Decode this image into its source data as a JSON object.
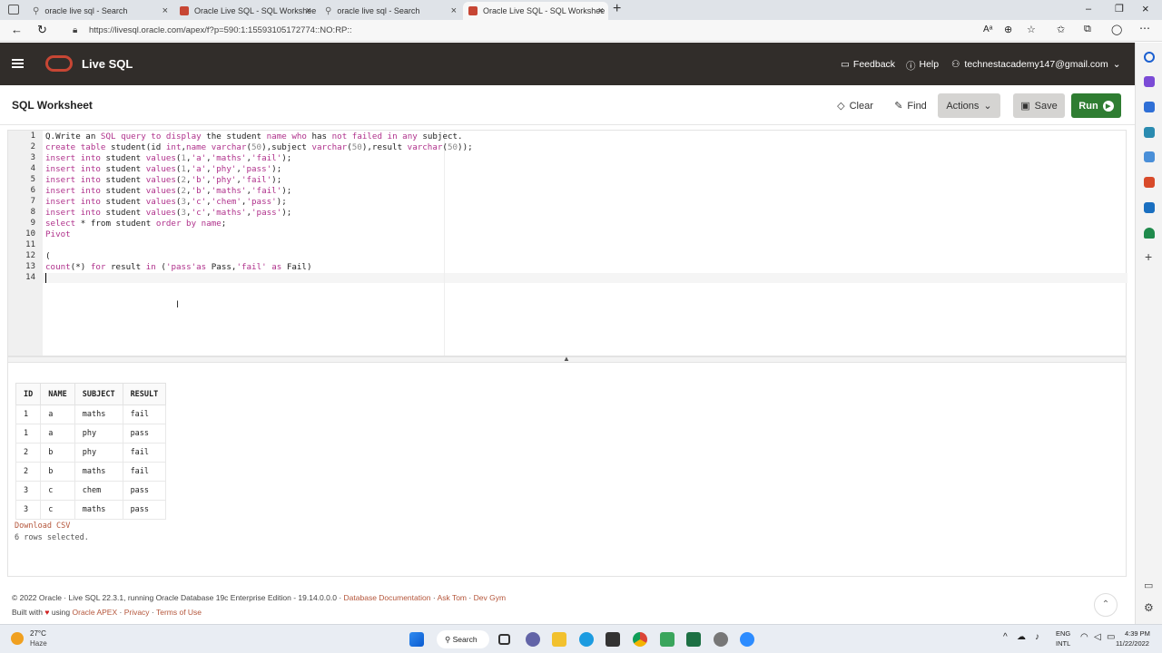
{
  "browser": {
    "tabs": [
      {
        "title": "oracle live sql - Search",
        "active": false
      },
      {
        "title": "Oracle Live SQL - SQL Workshee",
        "active": true
      },
      {
        "title": "oracle live sql - Search",
        "active": false
      },
      {
        "title": "Oracle Live SQL - SQL Workshee",
        "active": true
      }
    ],
    "new_tab": "+",
    "url": "https://livesql.oracle.com/apex/f?p=590:1:15593105172774::NO:RP::"
  },
  "app": {
    "name": "Live SQL",
    "feedback": "Feedback",
    "help": "Help",
    "user": "technestacademy147@gmail.com"
  },
  "worksheet": {
    "title": "SQL Worksheet",
    "clear": "Clear",
    "find": "Find",
    "actions": "Actions",
    "save": "Save",
    "run": "Run"
  },
  "editor": {
    "line_numbers": [
      "1",
      "2",
      "3",
      "4",
      "5",
      "6",
      "7",
      "8",
      "9",
      "10",
      "11",
      "12",
      "13",
      "14"
    ],
    "lines": [
      "Q.Write an SQL query to display the student name who has not failed in any subject.",
      "create table student(id int,name varchar(50),subject varchar(50),result varchar(50));",
      "insert into student values(1,'a','maths','fail');",
      "insert into student values(1,'a','phy','pass');",
      "insert into student values(2,'b','phy','fail');",
      "insert into student values(2,'b','maths','fail');",
      "insert into student values(3,'c','chem','pass');",
      "insert into student values(3,'c','maths','pass');",
      "select * from student order by name;",
      "Pivot",
      "",
      "(",
      "count(*) for result in ('pass'as Pass,'fail' as Fail)",
      ""
    ]
  },
  "results": {
    "columns": [
      "ID",
      "NAME",
      "SUBJECT",
      "RESULT"
    ],
    "rows": [
      [
        "1",
        "a",
        "maths",
        "fail"
      ],
      [
        "1",
        "a",
        "phy",
        "pass"
      ],
      [
        "2",
        "b",
        "phy",
        "fail"
      ],
      [
        "2",
        "b",
        "maths",
        "fail"
      ],
      [
        "3",
        "c",
        "chem",
        "pass"
      ],
      [
        "3",
        "c",
        "maths",
        "pass"
      ]
    ],
    "download": "Download CSV",
    "summary": "6 rows selected."
  },
  "footer": {
    "line1_text": "© 2022 Oracle · Live SQL 22.3.1, running Oracle Database 19c Enterprise Edition - 19.14.0.0.0 ·",
    "doc_link": "Database Documentation",
    "sep1": "·",
    "asktom": "Ask Tom",
    "sep2": "·",
    "devgym": "Dev Gym",
    "built_with": "Built with",
    "heart": "♥",
    "using": "using",
    "apex": "Oracle APEX",
    "privacy": "Privacy",
    "terms": "Terms of Use"
  },
  "taskbar": {
    "weather_temp": "27°C",
    "weather_desc": "Haze",
    "search": "Search",
    "lang1": "ENG",
    "lang2": "INTL",
    "time": "4:39 PM",
    "date": "11/22/2022"
  },
  "colors": {
    "oracle_red": "#c74634",
    "header_bg": "#312d2a",
    "run_green": "#2f7d32",
    "keyword": "#b0328c"
  }
}
